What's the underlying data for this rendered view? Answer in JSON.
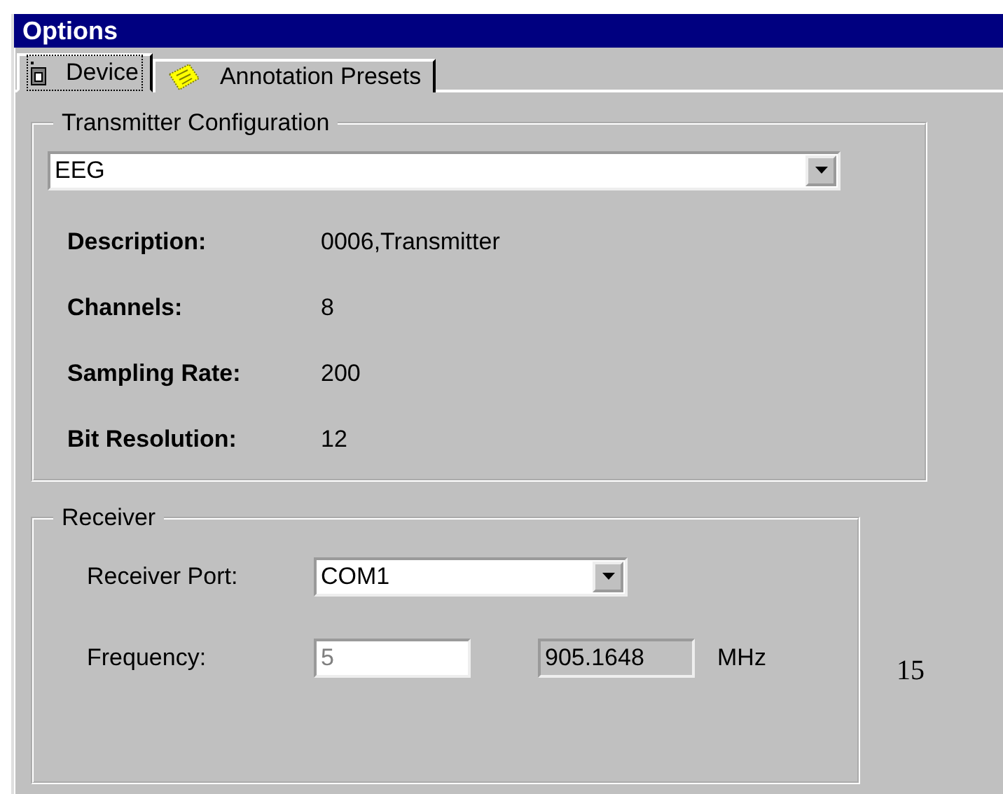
{
  "window": {
    "title": "Options"
  },
  "tabs": [
    {
      "label": "Device",
      "selected": true
    },
    {
      "label": "Annotation Presets",
      "selected": false
    }
  ],
  "transmitter": {
    "title": "Transmitter Configuration",
    "type": "EEG",
    "fields": [
      {
        "label": "Description:",
        "value": "0006,Transmitter"
      },
      {
        "label": "Channels:",
        "value": "8"
      },
      {
        "label": "Sampling Rate:",
        "value": "200"
      },
      {
        "label": "Bit Resolution:",
        "value": "12"
      }
    ]
  },
  "receiver": {
    "title": "Receiver",
    "port_label": "Receiver Port:",
    "port": "COM1",
    "frequency_label": "Frequency:",
    "frequency": {
      "value": "5",
      "disabled": true
    },
    "readout": "905.1648",
    "unit": "MHz"
  },
  "page_number": "15"
}
